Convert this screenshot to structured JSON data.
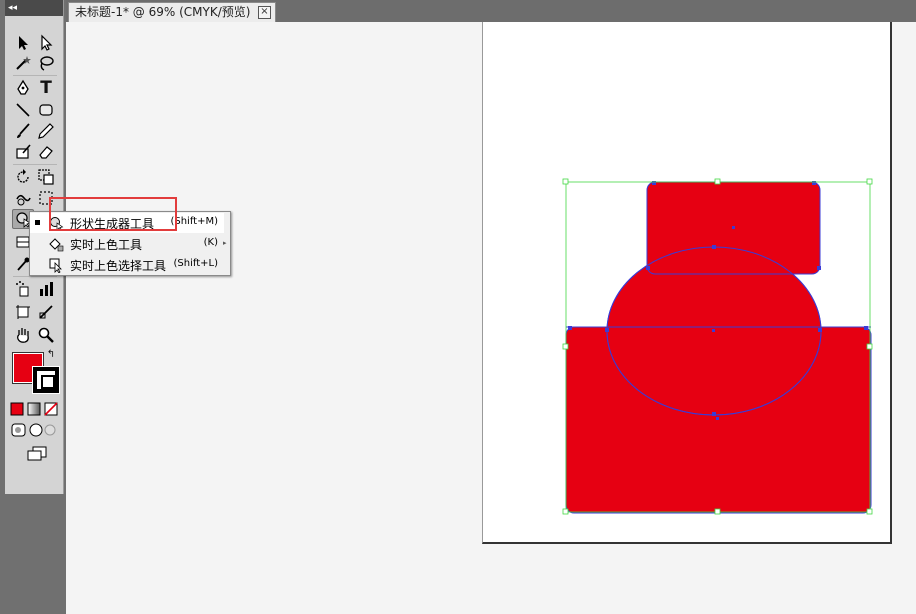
{
  "tab": {
    "title": "未标题-1* @ 69% (CMYK/预览)",
    "close_glyph": "⊠"
  },
  "toolbar": {
    "collapse_glyph": "◂◂",
    "text_tool_glyph": "T",
    "fill_color": "#e60012",
    "stroke_color": "#000000"
  },
  "flyout": {
    "items": [
      {
        "label": "形状生成器工具",
        "shortcut": "(Shift+M)",
        "icon": "shape-builder-icon",
        "selected": true
      },
      {
        "label": "实时上色工具",
        "shortcut": "(K)",
        "icon": "live-paint-bucket-icon",
        "selected": false
      },
      {
        "label": "实时上色选择工具",
        "shortcut": "(Shift+L)",
        "icon": "live-paint-selection-icon",
        "selected": false
      }
    ]
  },
  "artwork": {
    "fill": "#e60012",
    "path_stroke": "#3b3bd6",
    "bounding_box_color": "#43d843"
  }
}
